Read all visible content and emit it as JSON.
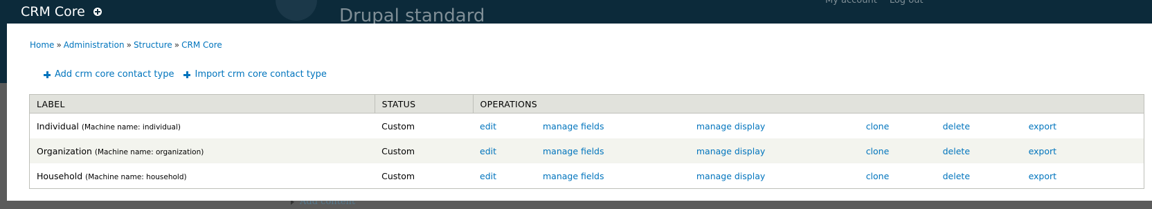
{
  "background": {
    "site_name": "Drupal standard",
    "user_menu": [
      "My account",
      "Log out"
    ],
    "add_content": "Add content"
  },
  "overlay": {
    "title": "CRM Core",
    "shortcut_icon": "add-shortcut-icon"
  },
  "breadcrumb": [
    "Home",
    "Administration",
    "Structure",
    "CRM Core"
  ],
  "breadcrumb_separator": "»",
  "actions": [
    {
      "label": "Add crm core contact type",
      "icon": "plus-icon"
    },
    {
      "label": "Import crm core contact type",
      "icon": "plus-icon"
    }
  ],
  "table": {
    "headers": [
      "LABEL",
      "STATUS",
      "OPERATIONS"
    ],
    "rows": [
      {
        "label": "Individual",
        "machine": "(Machine name: individual)",
        "status": "Custom",
        "ops": [
          "edit",
          "manage fields",
          "manage display",
          "clone",
          "delete",
          "export"
        ]
      },
      {
        "label": "Organization",
        "machine": "(Machine name: organization)",
        "status": "Custom",
        "ops": [
          "edit",
          "manage fields",
          "manage display",
          "clone",
          "delete",
          "export"
        ]
      },
      {
        "label": "Household",
        "machine": "(Machine name: household)",
        "status": "Custom",
        "ops": [
          "edit",
          "manage fields",
          "manage display",
          "clone",
          "delete",
          "export"
        ]
      }
    ]
  },
  "colors": {
    "header_bg": "#0c2a3a",
    "link": "#0074bd",
    "table_header_bg": "#e1e2dc",
    "row_stripe": "#f3f4ee"
  }
}
